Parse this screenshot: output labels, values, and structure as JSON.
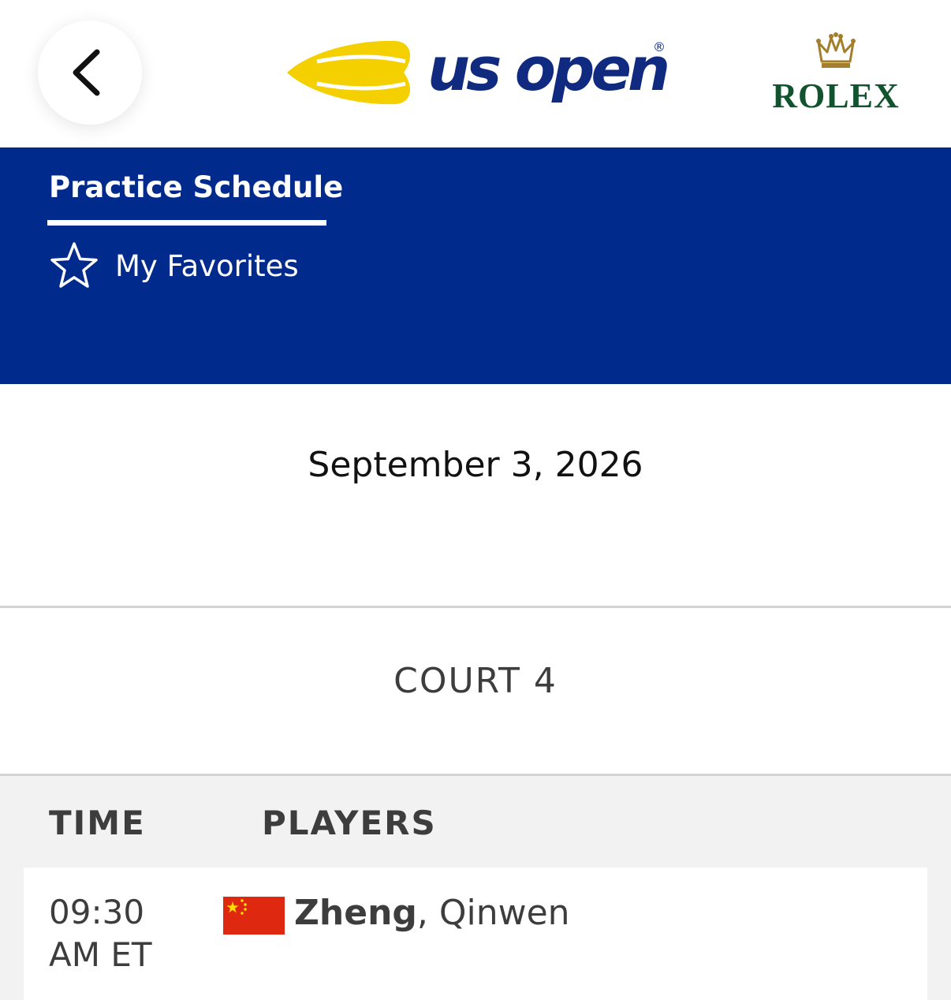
{
  "header": {
    "brand_text": "us open",
    "brand_registered": "®",
    "sponsor": "ROLEX"
  },
  "nav": {
    "active_tab": "Practice Schedule",
    "favorites_label": "My Favorites"
  },
  "schedule": {
    "date": "September 3, 2026",
    "court": "COURT 4",
    "columns": {
      "time": "TIME",
      "players": "PLAYERS"
    },
    "rows": [
      {
        "time_line1": "09:30",
        "time_line2": "AM ET",
        "player_last": "Zheng",
        "player_sep": ", ",
        "player_first": "Qinwen",
        "flag": "china-flag"
      }
    ]
  },
  "colors": {
    "nav_blue": "#002a8c",
    "brand_navy": "#0f2a7f",
    "brand_yellow": "#f5d000",
    "rolex_green": "#12532f",
    "rolex_gold": "#a37e2c",
    "flag_red": "#de2910",
    "flag_yellow": "#ffde00"
  }
}
